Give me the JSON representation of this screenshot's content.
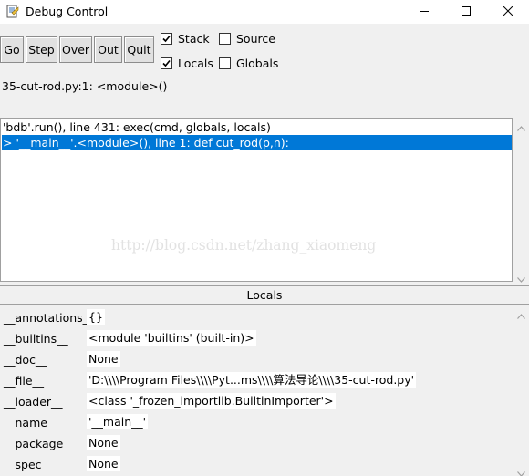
{
  "window": {
    "title": "Debug Control",
    "controls": [
      "minimize-icon",
      "maximize-icon",
      "close-icon"
    ]
  },
  "toolbar": {
    "go_label": "Go",
    "step_label": "Step",
    "over_label": "Over",
    "out_label": "Out",
    "quit_label": "Quit"
  },
  "options": {
    "stack": {
      "label": "Stack",
      "checked": true
    },
    "source": {
      "label": "Source",
      "checked": false
    },
    "locals": {
      "label": "Locals",
      "checked": true
    },
    "globals": {
      "label": "Globals",
      "checked": false
    }
  },
  "status": "35-cut-rod.py:1: <module>()",
  "stack": {
    "frames": [
      {
        "text": "'bdb'.run(), line 431: exec(cmd, globals, locals)",
        "selected": false
      },
      {
        "text": "> '__main__'.<module>(), line 1: def cut_rod(p,n):",
        "selected": true
      }
    ]
  },
  "watermark": "http://blog.csdn.net/zhang_xiaomeng",
  "locals": {
    "header": "Locals",
    "vars": [
      {
        "name": "__annotations__",
        "value": "{}"
      },
      {
        "name": "__builtins__",
        "value": "<module 'builtins' (built-in)>"
      },
      {
        "name": "__doc__",
        "value": "None"
      },
      {
        "name": "__file__",
        "value": "'D:\\\\\\\\Program Files\\\\\\\\Pyt...ms\\\\\\\\算法导论\\\\\\\\35-cut-rod.py'"
      },
      {
        "name": "__loader__",
        "value": "<class '_frozen_importlib.BuiltinImporter'>"
      },
      {
        "name": "__name__",
        "value": "'__main__'"
      },
      {
        "name": "__package__",
        "value": "None"
      },
      {
        "name": "__spec__",
        "value": "None"
      }
    ]
  },
  "colors": {
    "selection": "#0078d7",
    "window_bg": "#f0f0f0",
    "list_bg": "#ffffff"
  }
}
